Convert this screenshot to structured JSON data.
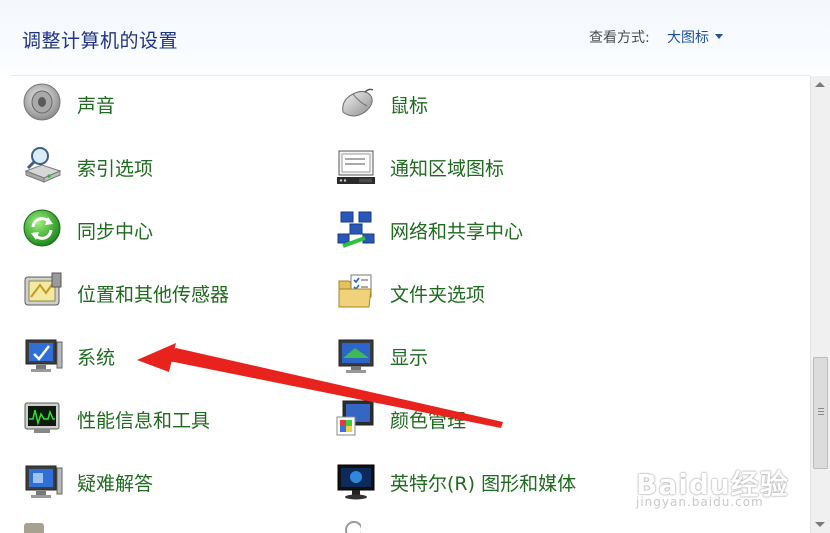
{
  "header": {
    "title": "调整计算机的设置",
    "view_label": "查看方式:",
    "view_value": "大图标"
  },
  "items": [
    {
      "label": "声音",
      "icon": "speaker-icon"
    },
    {
      "label": "鼠标",
      "icon": "mouse-icon"
    },
    {
      "label": "索引选项",
      "icon": "indexing-icon"
    },
    {
      "label": "通知区域图标",
      "icon": "notification-area-icon"
    },
    {
      "label": "同步中心",
      "icon": "sync-center-icon"
    },
    {
      "label": "网络和共享中心",
      "icon": "network-sharing-icon"
    },
    {
      "label": "位置和其他传感器",
      "icon": "location-sensors-icon"
    },
    {
      "label": "文件夹选项",
      "icon": "folder-options-icon"
    },
    {
      "label": "系统",
      "icon": "system-icon"
    },
    {
      "label": "显示",
      "icon": "display-icon"
    },
    {
      "label": "性能信息和工具",
      "icon": "performance-icon"
    },
    {
      "label": "颜色管理",
      "icon": "color-management-icon"
    },
    {
      "label": "疑难解答",
      "icon": "troubleshooting-icon"
    },
    {
      "label": "英特尔(R) 图形和媒体",
      "icon": "intel-graphics-icon"
    }
  ],
  "watermark": {
    "logo": "Baidu经验",
    "url": "jingyan.baidu.com"
  },
  "colors": {
    "title": "#1e3287",
    "link": "#1f6b1f",
    "view_value": "#1e50a0",
    "arrow": "#e8231d"
  }
}
